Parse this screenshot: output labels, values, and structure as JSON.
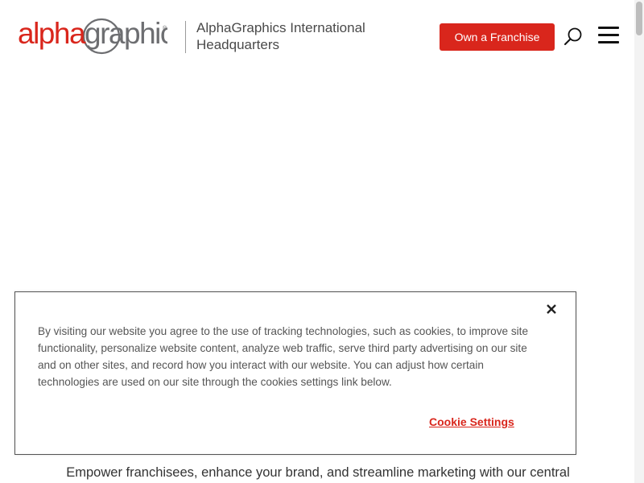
{
  "header": {
    "logo_text": "alphagraphics",
    "logo_alpha": "alpha",
    "logo_graphics": "graphics",
    "logo_registered": "®",
    "hq_title": "AlphaGraphics International Headquarters",
    "franchise_button": "Own a Franchise",
    "search_icon": "search-icon",
    "menu_icon": "hamburger-menu-icon"
  },
  "hero": {
    "subtitle": "Empower franchisees, enhance your brand, and streamline marketing with our central"
  },
  "cookie_banner": {
    "text": "By visiting our website you agree to the use of tracking technologies, such as cookies, to improve site functionality, personalize website content, analyze web traffic, serve third party advertising on our site and on other sites, and record how you interact with our website. You can adjust how certain technologies are used on our site through the cookies settings link below.",
    "settings_link": "Cookie Settings",
    "close_icon": "close-icon"
  },
  "colors": {
    "brand_red": "#d9261c",
    "logo_gray": "#6d6e71",
    "text_dark": "#333333"
  }
}
